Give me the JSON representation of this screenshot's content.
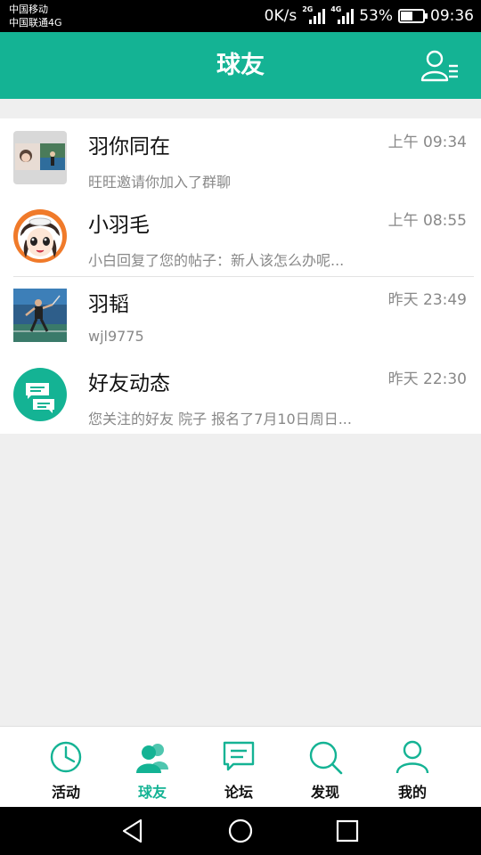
{
  "status_bar": {
    "carrier_1": "中国移动",
    "carrier_2": "中国联通4G",
    "net_speed": "0K/s",
    "sim1_type": "2G",
    "sim2_type": "4G",
    "battery_percent": "53%",
    "battery_level": 0.53,
    "clock": "09:36"
  },
  "header": {
    "title": "球友",
    "contacts_icon": "contacts-list-icon"
  },
  "conversations": [
    {
      "name": "羽你同在",
      "preview": "旺旺邀请你加入了群聊",
      "time": "上午 09:34",
      "avatar": "group-photo-avatar"
    },
    {
      "name": "小羽毛",
      "preview": "小白回复了您的帖子：新人该怎么办呢...",
      "time": "上午 08:55",
      "avatar": "cartoon-girl-avatar"
    },
    {
      "name": "羽韬",
      "preview": "wjl9775",
      "time": "昨天 23:49",
      "avatar": "badminton-player-avatar"
    },
    {
      "name": "好友动态",
      "preview": "您关注的好友 院子 报名了7月10日周日...",
      "time": "昨天 22:30",
      "avatar": "chat-bubbles-icon"
    }
  ],
  "bottom_nav": {
    "items": [
      {
        "label": "活动",
        "icon": "clock-icon"
      },
      {
        "label": "球友",
        "icon": "friends-icon"
      },
      {
        "label": "论坛",
        "icon": "forum-icon"
      },
      {
        "label": "发现",
        "icon": "search-icon"
      },
      {
        "label": "我的",
        "icon": "profile-icon"
      }
    ],
    "active_index": 1
  },
  "system_nav": {
    "back": "back-triangle-icon",
    "home": "home-circle-icon",
    "recents": "recents-square-icon"
  },
  "colors": {
    "accent": "#14b394",
    "text_secondary": "#888888"
  }
}
